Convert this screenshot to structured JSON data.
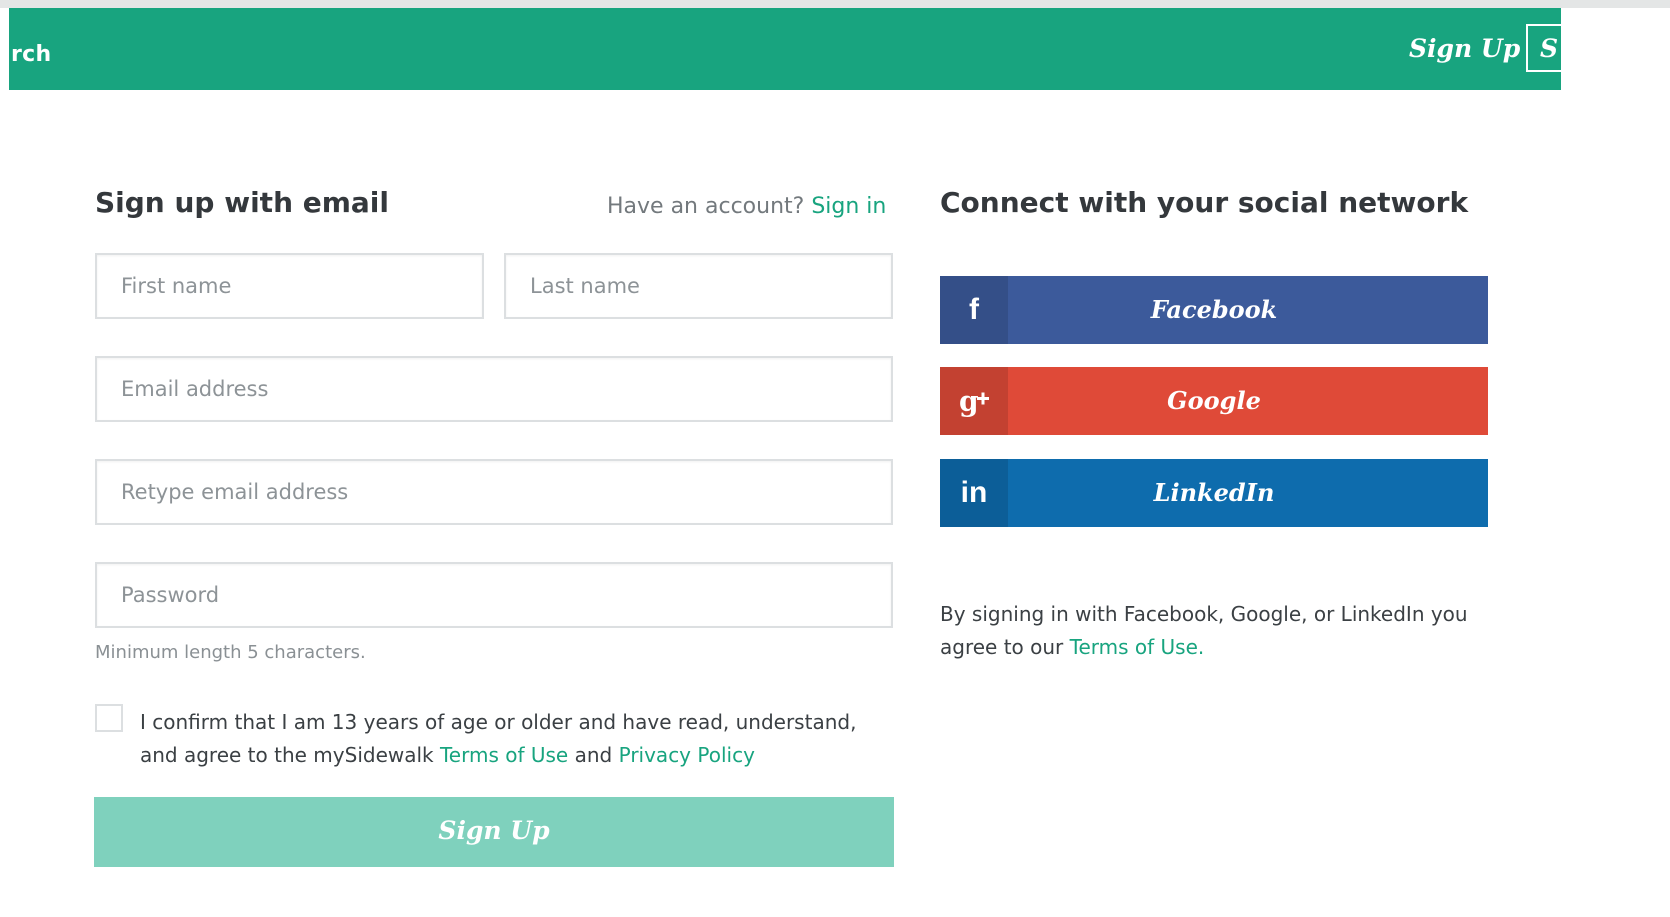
{
  "nav": {
    "search_fragment": "rch",
    "signup_label": "Sign Up",
    "signin_fragment": "S",
    "bg_color": "#18a47f"
  },
  "email_form": {
    "heading": "Sign up with email",
    "have_account_text": "Have an account?",
    "signin_link": "Sign in",
    "first_name_placeholder": "First name",
    "last_name_placeholder": "Last name",
    "email_placeholder": "Email address",
    "retype_email_placeholder": "Retype email address",
    "password_placeholder": "Password",
    "password_hint": "Minimum length 5 characters.",
    "confirm_text_1": "I confirm that I am 13 years of age or older and have read, understand, and agree to the mySidewalk",
    "terms_link": "Terms of Use",
    "and_text": "and",
    "privacy_link": "Privacy Policy",
    "submit_label": "Sign Up",
    "accent_color": "#18a47f"
  },
  "social": {
    "heading": "Connect with your social network",
    "buttons": [
      {
        "label": "Facebook",
        "icon": "facebook-icon",
        "color": "#3c5a9b"
      },
      {
        "label": "Google",
        "icon": "google-plus-icon",
        "color": "#df4a38"
      },
      {
        "label": "LinkedIn",
        "icon": "linkedin-icon",
        "color": "#0e6cad"
      }
    ],
    "note_text": "By signing in with Facebook, Google, or LinkedIn you agree to our",
    "note_terms_link": "Terms of Use."
  }
}
